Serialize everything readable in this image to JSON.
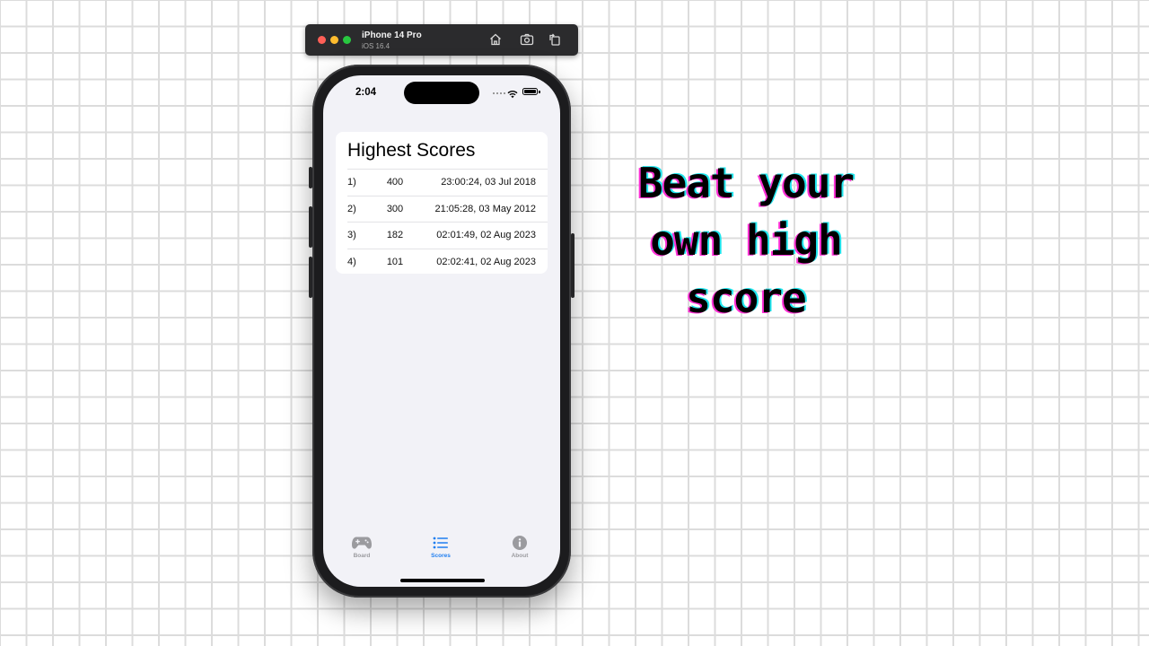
{
  "simulator": {
    "device_name": "iPhone 14 Pro",
    "os_version": "iOS 16.4",
    "icons": [
      "home-icon",
      "screenshot-icon",
      "rotate-icon"
    ]
  },
  "status_bar": {
    "time": "2:04"
  },
  "scores_card": {
    "title": "Highest Scores",
    "rows": [
      {
        "rank": "1)",
        "score": "400",
        "timestamp": "23:00:24, 03 Jul 2018"
      },
      {
        "rank": "2)",
        "score": "300",
        "timestamp": "21:05:28, 03 May 2012"
      },
      {
        "rank": "3)",
        "score": "182",
        "timestamp": "02:01:49, 02 Aug 2023"
      },
      {
        "rank": "4)",
        "score": "101",
        "timestamp": "02:02:41, 02 Aug 2023"
      }
    ]
  },
  "tab_bar": {
    "tabs": [
      {
        "label": "Board",
        "icon": "gamecontroller-icon",
        "active": false
      },
      {
        "label": "Scores",
        "icon": "list-icon",
        "active": true
      },
      {
        "label": "About",
        "icon": "info-icon",
        "active": false
      }
    ]
  },
  "headline": {
    "lines": [
      "Beat your",
      "own high",
      "score"
    ]
  },
  "colors": {
    "accent": "#1f7ef0",
    "inactive_tab": "#9b9b9f",
    "screen_background": "#f2f2f7",
    "headline_shadow_pink": "#ff2fd6",
    "headline_shadow_cyan": "#1fe6ee"
  }
}
